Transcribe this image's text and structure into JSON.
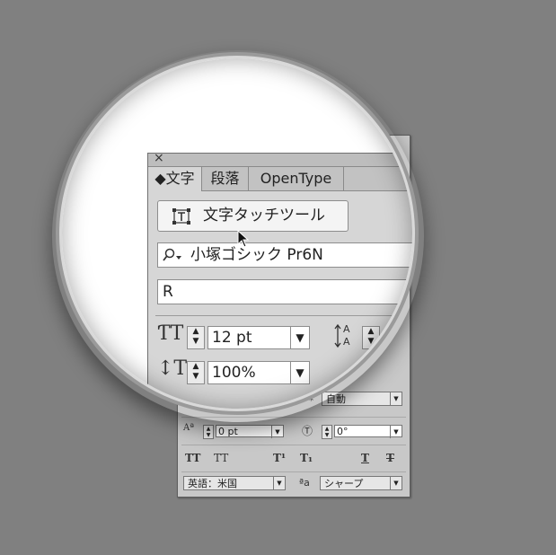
{
  "panel": {
    "close_glyph": "×",
    "tabs": [
      {
        "label": "◆文字",
        "active": true
      },
      {
        "label": "段落",
        "active": false
      },
      {
        "label": "OpenType",
        "active": false
      }
    ],
    "touch_tool_button": {
      "label": "文字タッチツール",
      "icon": "touch-type-tool-icon"
    },
    "font_family": {
      "icon": "search-dropdown-icon",
      "value": "小塚ゴシック Pr6N"
    },
    "font_style": {
      "value": "R"
    },
    "font_size": {
      "icon": "font-size-icon",
      "value": "12 pt"
    },
    "vertical_scale": {
      "icon": "vertical-scale-icon",
      "value": "100%"
    },
    "leading": {
      "icon": "leading-icon"
    },
    "kerning": {
      "value": "自動"
    },
    "baseline_shift": {
      "value": "0 pt"
    },
    "rotation": {
      "value": "0°"
    },
    "text_styles": [
      "TT",
      "TT",
      "T¹",
      "T₁",
      "T",
      "T"
    ],
    "language": {
      "value": "英語：米国"
    },
    "antialias": {
      "icon": "aa-icon",
      "glyph": "ªa",
      "value": "シャープ"
    }
  }
}
